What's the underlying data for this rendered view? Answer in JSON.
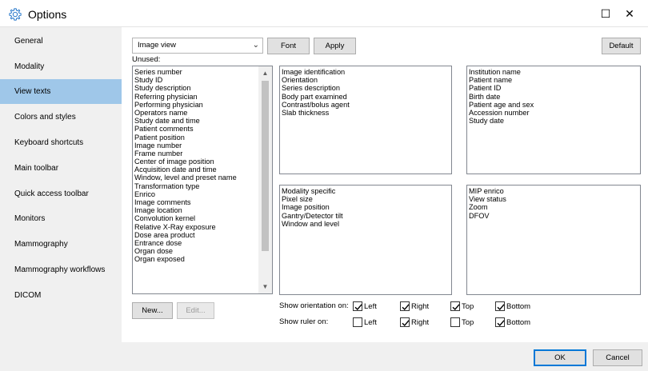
{
  "window": {
    "title": "Options",
    "maximize_symbol": "☐",
    "close_symbol": "✕"
  },
  "sidebar": {
    "items": [
      {
        "label": "General"
      },
      {
        "label": "Modality"
      },
      {
        "label": "View texts",
        "active": true
      },
      {
        "label": "Colors and styles"
      },
      {
        "label": "Keyboard shortcuts"
      },
      {
        "label": "Main toolbar"
      },
      {
        "label": "Quick access toolbar"
      },
      {
        "label": "Monitors"
      },
      {
        "label": "Mammography"
      },
      {
        "label": "Mammography workflows"
      },
      {
        "label": "DICOM"
      }
    ]
  },
  "toolbar": {
    "view_select_value": "Image view",
    "font_label": "Font",
    "apply_label": "Apply",
    "default_label": "Default"
  },
  "unused": {
    "label": "Unused:",
    "items": [
      "Series number",
      "Study ID",
      "Study description",
      "Referring physician",
      "Performing physician",
      "Operators name",
      "Study date and time",
      "Patient comments",
      "Patient position",
      "Image number",
      "Frame number",
      "Center of image position",
      "Acquisition date and time",
      "Window, level and preset name",
      "Transformation type",
      "Enrico",
      "Image comments",
      "Image location",
      "Convolution kernel",
      "Relative X-Ray exposure",
      "Dose area product",
      "Entrance dose",
      "Organ dose",
      "Organ exposed"
    ],
    "new_label": "New...",
    "edit_label": "Edit..."
  },
  "corners": {
    "top_left": [
      "Image identification",
      "Orientation",
      "Series description",
      "Body part examined",
      "Contrast/bolus agent",
      "Slab thickness"
    ],
    "top_right": [
      "Institution name",
      "Patient name",
      "Patient ID",
      "Birth date",
      "Patient age and sex",
      "Accession number",
      "Study date"
    ],
    "bottom_left": [
      "Modality specific",
      "Pixel size",
      "Image position",
      "Gantry/Detector tilt",
      "Window and level"
    ],
    "bottom_right": [
      "MIP enrico",
      "View status",
      "Zoom",
      "DFOV"
    ]
  },
  "orientation": {
    "label": "Show orientation on:",
    "left": {
      "label": "Left",
      "checked": true
    },
    "right": {
      "label": "Right",
      "checked": true
    },
    "top": {
      "label": "Top",
      "checked": true
    },
    "bottom": {
      "label": "Bottom",
      "checked": true
    }
  },
  "ruler": {
    "label": "Show ruler on:",
    "left": {
      "label": "Left",
      "checked": false
    },
    "right": {
      "label": "Right",
      "checked": true
    },
    "top": {
      "label": "Top",
      "checked": false
    },
    "bottom": {
      "label": "Bottom",
      "checked": true
    }
  },
  "footer": {
    "ok_label": "OK",
    "cancel_label": "Cancel"
  },
  "colors": {
    "active_item": "#9fc7e9",
    "accent": "#0078d7",
    "gear": "#1e72c8"
  }
}
